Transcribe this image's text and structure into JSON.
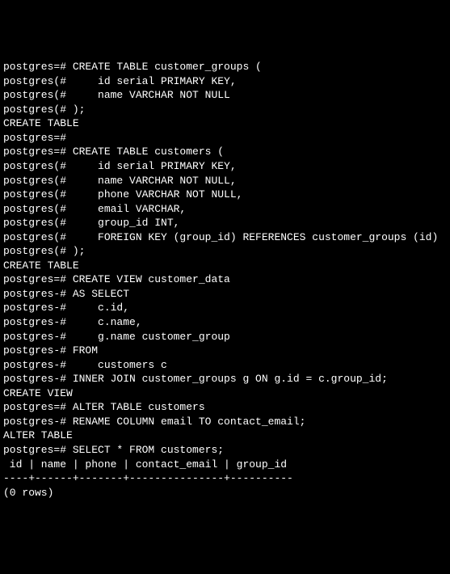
{
  "lines": [
    "postgres=# CREATE TABLE customer_groups (",
    "postgres(#     id serial PRIMARY KEY,",
    "postgres(#     name VARCHAR NOT NULL",
    "postgres(# );",
    "CREATE TABLE",
    "postgres=#",
    "postgres=# CREATE TABLE customers (",
    "postgres(#     id serial PRIMARY KEY,",
    "postgres(#     name VARCHAR NOT NULL,",
    "postgres(#     phone VARCHAR NOT NULL,",
    "postgres(#     email VARCHAR,",
    "postgres(#     group_id INT,",
    "postgres(#     FOREIGN KEY (group_id) REFERENCES customer_groups (id)",
    "postgres(# );",
    "CREATE TABLE",
    "postgres=# CREATE VIEW customer_data",
    "postgres-# AS SELECT",
    "postgres-#     c.id,",
    "postgres-#     c.name,",
    "postgres-#     g.name customer_group",
    "postgres-# FROM",
    "postgres-#     customers c",
    "postgres-# INNER JOIN customer_groups g ON g.id = c.group_id;",
    "CREATE VIEW",
    "postgres=# ALTER TABLE customers",
    "postgres-# RENAME COLUMN email TO contact_email;",
    "ALTER TABLE",
    "postgres=# SELECT * FROM customers;",
    " id | name | phone | contact_email | group_id",
    "----+------+-------+---------------+----------",
    "(0 rows)"
  ]
}
